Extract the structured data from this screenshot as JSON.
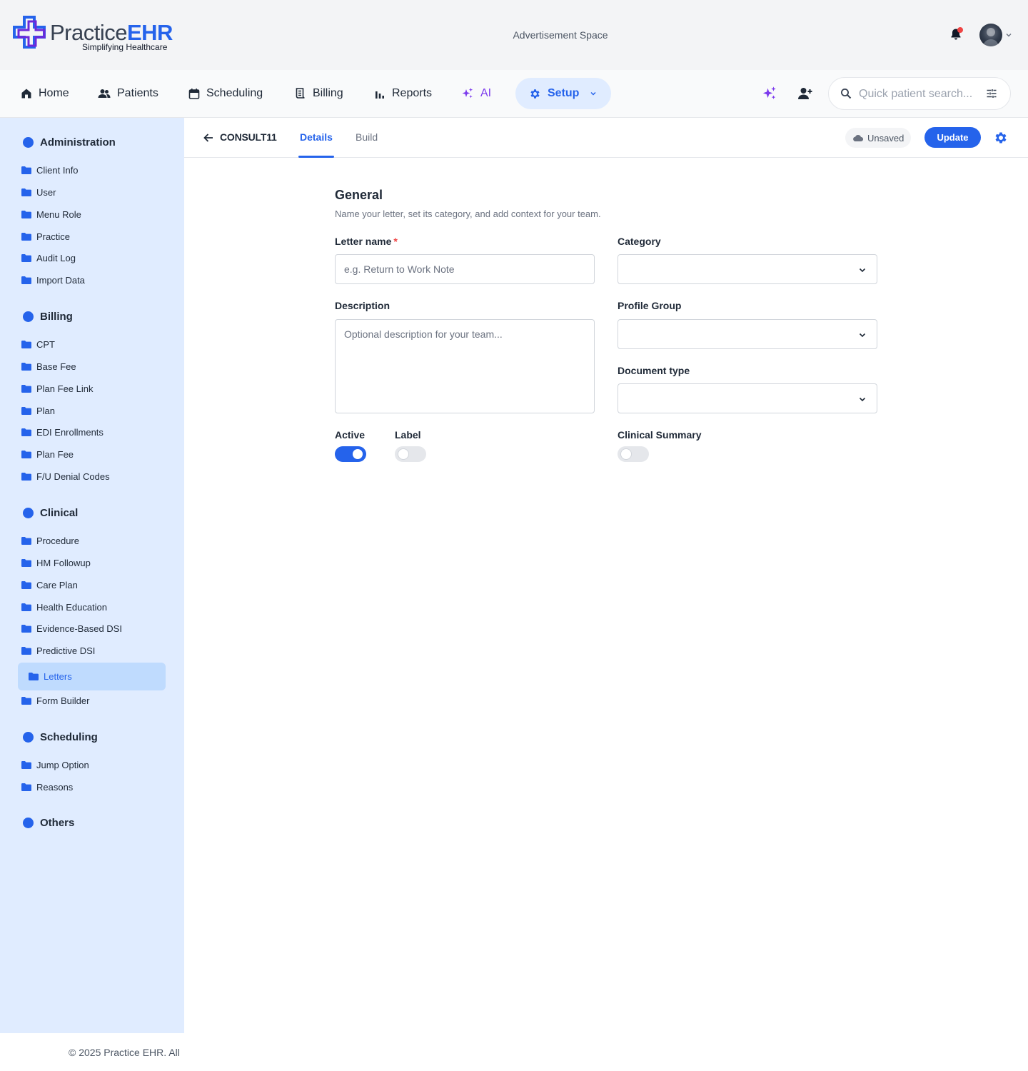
{
  "brand": {
    "name_part1": "Practice",
    "name_part2": "EHR",
    "tagline": "Simplifying Healthcare"
  },
  "header": {
    "ad_text": "Advertisement Space"
  },
  "nav": {
    "items": [
      {
        "label": "Home",
        "icon": "home-icon"
      },
      {
        "label": "Patients",
        "icon": "patients-icon"
      },
      {
        "label": "Scheduling",
        "icon": "calendar-icon"
      },
      {
        "label": "Billing",
        "icon": "billing-icon"
      },
      {
        "label": "Reports",
        "icon": "bar-chart-icon"
      },
      {
        "label": "AI",
        "icon": "sparkle-icon"
      },
      {
        "label": "Setup",
        "icon": "gear-icon"
      }
    ],
    "search_placeholder": "Quick patient search..."
  },
  "sidebar": {
    "sections": [
      {
        "title": "Administration",
        "items": [
          "Client Info",
          "User",
          "Menu Role",
          "Practice",
          "Audit Log",
          "Import Data"
        ]
      },
      {
        "title": "Billing",
        "items": [
          "CPT",
          "Base Fee",
          "Plan Fee Link",
          "Plan",
          "EDI Enrollments",
          "Plan Fee",
          "F/U Denial Codes"
        ]
      },
      {
        "title": "Clinical",
        "items": [
          "Procedure",
          "HM Followup",
          "Care Plan",
          "Health Education",
          "Evidence-Based DSI",
          "Predictive DSI",
          "Letters",
          "Form Builder"
        ]
      },
      {
        "title": "Scheduling",
        "items": [
          "Jump Option",
          "Reasons"
        ]
      },
      {
        "title": "Others",
        "items": []
      }
    ],
    "active_item": "Letters"
  },
  "editor": {
    "record_name": "CONSULT11",
    "tabs": [
      "Details",
      "Build"
    ],
    "active_tab": "Details",
    "status": "Unsaved",
    "update_label": "Update"
  },
  "form": {
    "title": "General",
    "subtitle": "Name your letter, set its category, and add context for your team.",
    "letter_name": {
      "label": "Letter name",
      "required_mark": "*",
      "placeholder": "e.g. Return to Work Note",
      "value": ""
    },
    "category": {
      "label": "Category",
      "value": ""
    },
    "description": {
      "label": "Description",
      "placeholder": "Optional description for your team...",
      "value": ""
    },
    "profile_group": {
      "label": "Profile Group",
      "value": ""
    },
    "document_type": {
      "label": "Document type",
      "value": ""
    },
    "toggles": [
      {
        "label": "Active",
        "on": true
      },
      {
        "label": "Label",
        "on": false
      },
      {
        "label": "Clinical Summary",
        "on": false
      }
    ]
  },
  "footer": {
    "text": "© 2025 Practice EHR. All"
  },
  "colors": {
    "accent": "#2563eb",
    "sidebar_bg": "#e0ecff",
    "ai_purple": "#7c3aed",
    "notification": "#ef4444"
  }
}
